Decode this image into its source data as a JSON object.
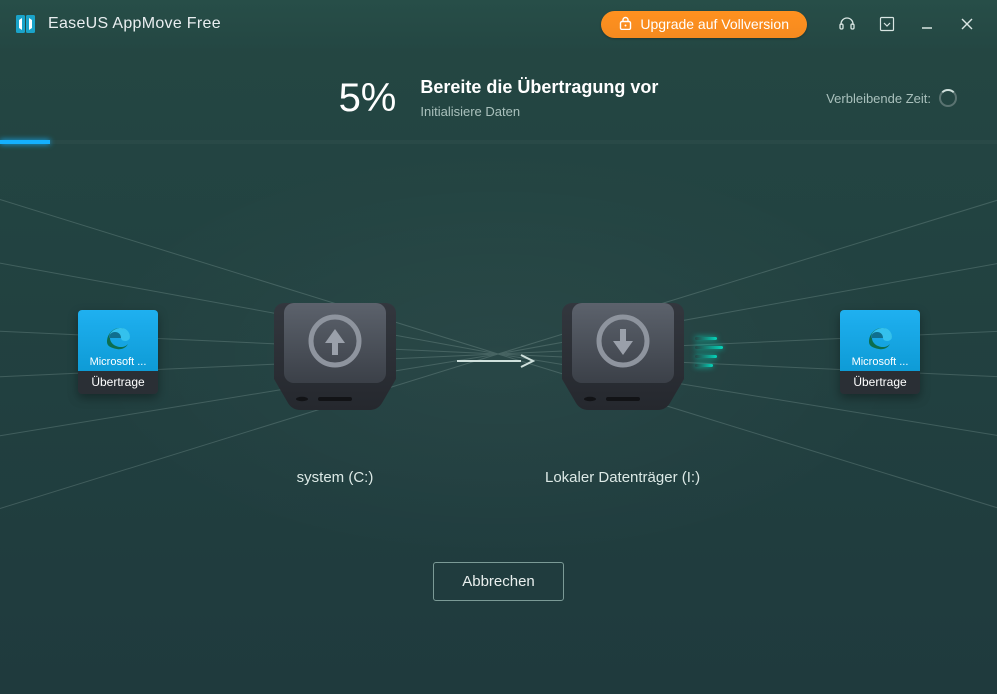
{
  "app": {
    "title": "EaseUS AppMove Free",
    "upgrade_label": "Upgrade auf Vollversion"
  },
  "progress": {
    "percent_text": "5%",
    "percent_value": 5,
    "title": "Bereite die Übertragung vor",
    "subtitle": "Initialisiere Daten",
    "remaining_label": "Verbleibende Zeit:"
  },
  "drives": {
    "source_label": "system (C:)",
    "dest_label": "Lokaler Datenträger (I:)"
  },
  "apps": {
    "source": {
      "name": "Microsoft ...",
      "status": "Übertrage"
    },
    "dest": {
      "name": "Microsoft ...",
      "status": "Übertrage"
    }
  },
  "cancel_label": "Abbrechen",
  "icons": {
    "lock": "lock-icon",
    "headset": "headset-icon",
    "dropdown": "dropdown-icon",
    "minimize": "minimize-icon",
    "close": "close-icon",
    "refresh": "refresh-icon",
    "arrow_up": "arrow-up-icon",
    "arrow_down": "arrow-down-icon",
    "arrow_right": "arrow-right-icon",
    "app_logo": "app-logo-icon",
    "edge": "edge-icon"
  },
  "colors": {
    "accent": "#f58a1f",
    "progress": "#14b0ff",
    "tile": "#0e9bd6"
  }
}
